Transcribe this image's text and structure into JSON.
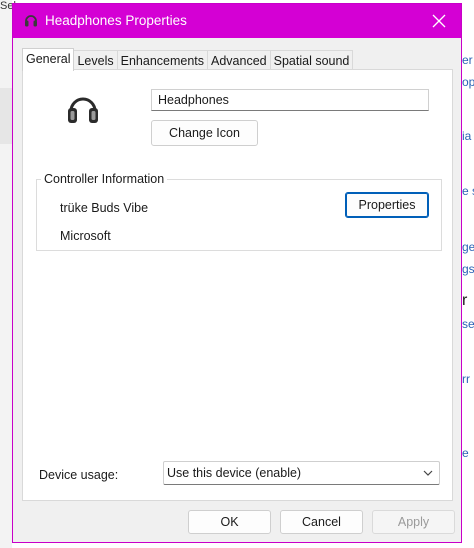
{
  "window": {
    "title": "Headphones Properties",
    "accent_color": "#d400d4",
    "icon": "headphones-icon"
  },
  "background": {
    "left_text": "Sel",
    "right_fragments": [
      "er",
      "op",
      "ia",
      "e s",
      "ge",
      "gs",
      "r",
      "se",
      "rr",
      "e"
    ]
  },
  "tabs": [
    {
      "label": "General",
      "active": true
    },
    {
      "label": "Levels",
      "active": false
    },
    {
      "label": "Enhancements",
      "active": false
    },
    {
      "label": "Advanced",
      "active": false
    },
    {
      "label": "Spatial sound",
      "active": false
    }
  ],
  "general": {
    "device_name": "Headphones",
    "change_icon_label": "Change Icon",
    "controller": {
      "legend": "Controller Information",
      "name": "trüke Buds Vibe",
      "manufacturer": "Microsoft",
      "properties_label": "Properties"
    },
    "device_usage": {
      "label": "Device usage:",
      "selected": "Use this device (enable)"
    }
  },
  "footer": {
    "ok_label": "OK",
    "cancel_label": "Cancel",
    "apply_label": "Apply"
  }
}
